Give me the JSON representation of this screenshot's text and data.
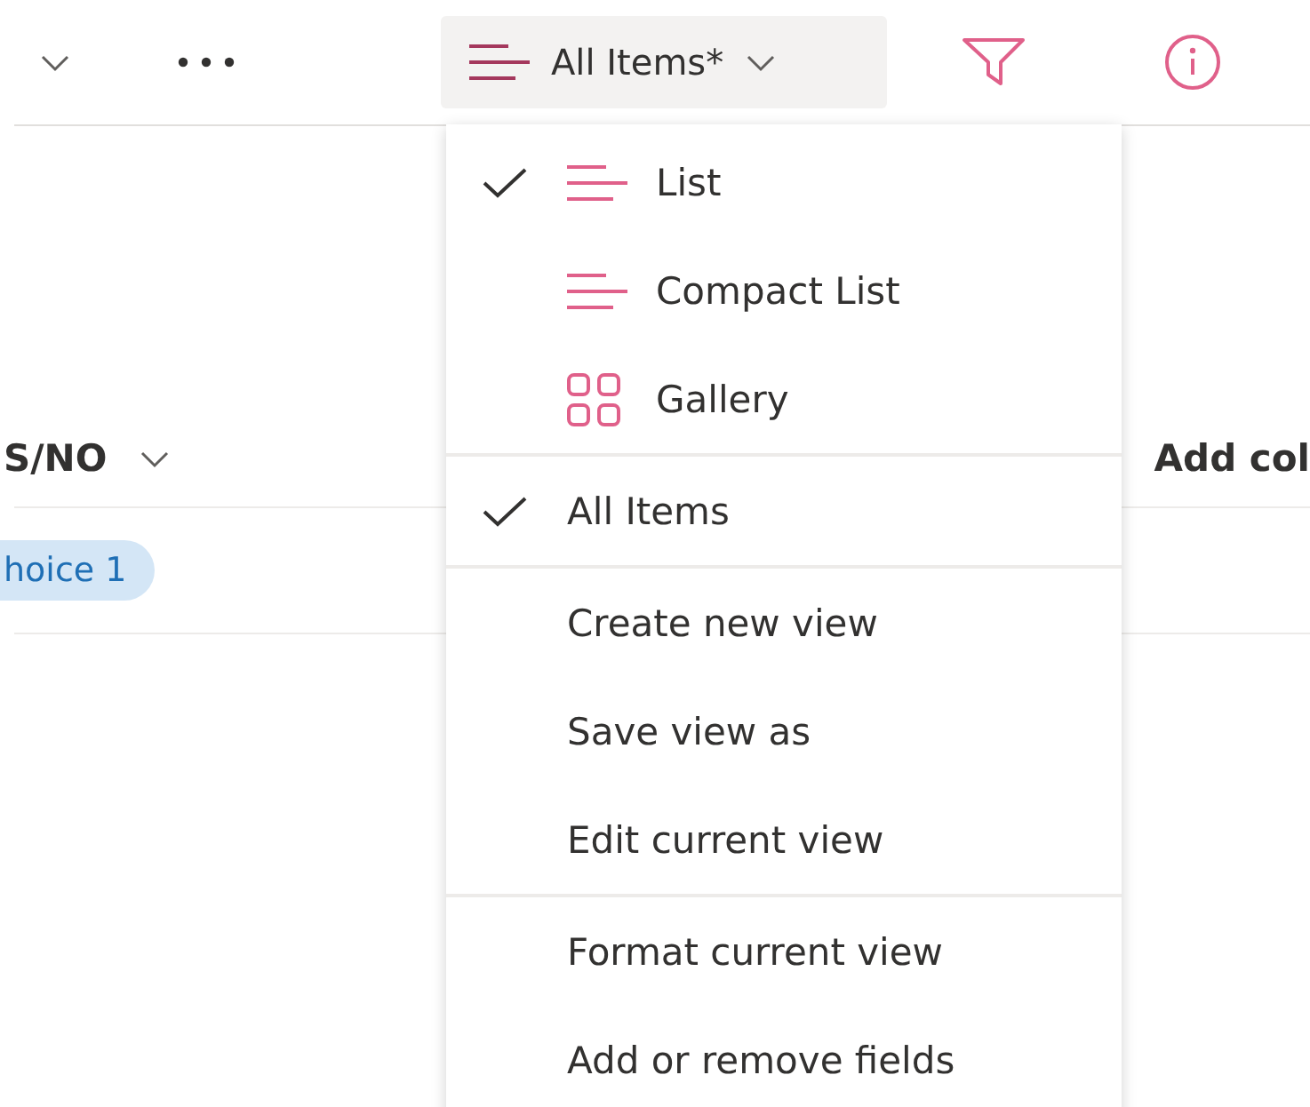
{
  "toolbar": {
    "view_button": {
      "label": "All Items*"
    }
  },
  "table": {
    "columns": [
      {
        "label": "S/NO",
        "sortable": true
      },
      {
        "label": "Add col"
      }
    ],
    "rows": [
      {
        "choice": "hoice 1"
      }
    ]
  },
  "view_menu": {
    "sections": [
      {
        "items": [
          {
            "label": "List",
            "kind": "list",
            "selected": true
          },
          {
            "label": "Compact List",
            "kind": "compact",
            "selected": false
          },
          {
            "label": "Gallery",
            "kind": "gallery",
            "selected": false
          }
        ]
      },
      {
        "items": [
          {
            "label": "All Items",
            "kind": "plain",
            "selected": true
          }
        ]
      },
      {
        "items": [
          {
            "label": "Create new view",
            "kind": "plain"
          },
          {
            "label": "Save view as",
            "kind": "plain"
          },
          {
            "label": "Edit current view",
            "kind": "plain"
          }
        ]
      },
      {
        "items": [
          {
            "label": "Format current view",
            "kind": "plain"
          },
          {
            "label": "Add or remove fields",
            "kind": "plain"
          }
        ]
      }
    ]
  }
}
